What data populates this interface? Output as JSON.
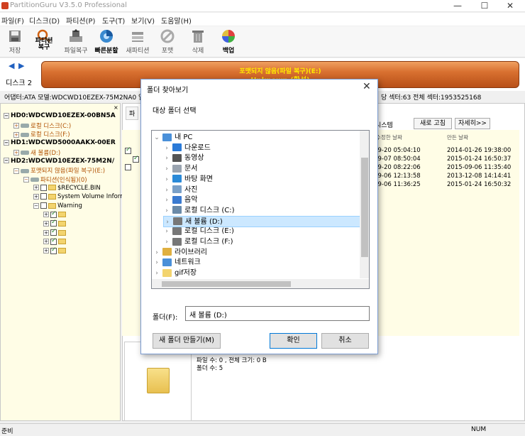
{
  "window": {
    "title": "PartitionGuru V3.5.0 Professional",
    "controls": [
      "—",
      "☐",
      "✕"
    ]
  },
  "menu": [
    "파일(F)",
    "디스크(D)",
    "파티션(P)",
    "도구(T)",
    "보기(V)",
    "도움말(H)"
  ],
  "toolbar": [
    {
      "label": "저장",
      "icon": "save-icon",
      "bold": false
    },
    {
      "label": "파티션\n복구",
      "icon": "search-icon",
      "bold": true
    },
    {
      "label": "파일복구",
      "icon": "file-recover-icon",
      "bold": false
    },
    {
      "label": "빠른분할",
      "icon": "quick-partition-icon",
      "bold": true
    },
    {
      "label": "새파티션",
      "icon": "new-partition-icon",
      "bold": false
    },
    {
      "label": "포맷",
      "icon": "format-icon",
      "bold": false
    },
    {
      "label": "삭제",
      "icon": "trash-icon",
      "bold": false
    },
    {
      "label": "백업",
      "icon": "backup-icon",
      "bold": true
    }
  ],
  "disk": {
    "label": "디스크 2",
    "line1": "포맷되지 않음(파일 복구)(E:)",
    "line2": "Unknown (활성)",
    "info": "어댑터:ATA  모델:WDCWD10EZEX-75M2NA0  일련",
    "info_right": "당 섹터:63  전체 섹터:1953525168"
  },
  "tree": [
    {
      "text": "HD0:WDCWD10EZEX-00BN5A",
      "indent": 0,
      "kind": "hd",
      "exp": "−"
    },
    {
      "text": "로컬 디스크(C:)",
      "indent": 1,
      "kind": "part",
      "exp": "+"
    },
    {
      "text": "로컬 디스크(F:)",
      "indent": 1,
      "kind": "part",
      "exp": "+"
    },
    {
      "text": "HD1:WDCWD5000AAKX-00ER",
      "indent": 0,
      "kind": "hd",
      "exp": "−"
    },
    {
      "text": "새 볼륨(D:)",
      "indent": 1,
      "kind": "part",
      "exp": "+"
    },
    {
      "text": "HD2:WDCWD10EZEX-75M2N/",
      "indent": 0,
      "kind": "hd",
      "exp": "−"
    },
    {
      "text": "포맷되지 않음(파일 복구)(E:)",
      "indent": 1,
      "kind": "part",
      "exp": "−"
    },
    {
      "text": "파티션(인식됨)(0)",
      "indent": 2,
      "kind": "part",
      "exp": "−"
    },
    {
      "text": "$RECYCLE.BIN",
      "indent": 3,
      "kind": "folder",
      "exp": "+"
    },
    {
      "text": "System Volume Inform",
      "indent": 3,
      "kind": "folder",
      "exp": "+"
    },
    {
      "text": "Warning",
      "indent": 3,
      "kind": "folder",
      "exp": "−"
    },
    {
      "text": "",
      "indent": 4,
      "kind": "folder",
      "exp": "+"
    },
    {
      "text": "",
      "indent": 4,
      "kind": "folder",
      "exp": "+"
    },
    {
      "text": "",
      "indent": 4,
      "kind": "folder",
      "exp": "+"
    },
    {
      "text": "",
      "indent": 4,
      "kind": "folder",
      "exp": "+"
    },
    {
      "text": "",
      "indent": 4,
      "kind": "folder",
      "exp": "+"
    }
  ],
  "right": {
    "tab": "파",
    "filesystem": "시스템",
    "refresh": "새로 고침",
    "detail": "자세히>>",
    "col_modified": "수정한 날짜",
    "col_created": "만든 날짜",
    "rows": [
      {
        "modified": "-09-20 05:04:10",
        "created": "2014-01-26 19:38:00"
      },
      {
        "modified": "-09-07 08:50:04",
        "created": "2015-01-24 16:50:37"
      },
      {
        "modified": "-09-20 08:22:06",
        "created": "2015-09-06 11:35:40"
      },
      {
        "modified": "-09-06 12:13:58",
        "created": "2013-12-08 14:14:41"
      },
      {
        "modified": "-09-06 11:36:25",
        "created": "2015-01-24 16:50:32"
      }
    ],
    "summary1": "파일 수: 0 , 전체 크기: 0 B",
    "summary2": "폴더 수: 5"
  },
  "status": {
    "left": "준비",
    "right": "NUM"
  },
  "dialog": {
    "title": "폴더 찾아보기",
    "subtitle": "대상 폴더 선택",
    "items": [
      {
        "label": "내 PC",
        "level": 0,
        "chev": "⌄",
        "icon": "pc-icon",
        "color": "#4a90d9"
      },
      {
        "label": "다운로드",
        "level": 1,
        "chev": "›",
        "icon": "download-icon",
        "color": "#2a7ad8"
      },
      {
        "label": "동영상",
        "level": 1,
        "chev": "›",
        "icon": "video-icon",
        "color": "#555555"
      },
      {
        "label": "문서",
        "level": 1,
        "chev": "›",
        "icon": "document-icon",
        "color": "#9aa4b0"
      },
      {
        "label": "바탕 화면",
        "level": 1,
        "chev": "›",
        "icon": "desktop-icon",
        "color": "#2a8ad8"
      },
      {
        "label": "사진",
        "level": 1,
        "chev": "›",
        "icon": "pictures-icon",
        "color": "#7aa0c8"
      },
      {
        "label": "음악",
        "level": 1,
        "chev": "›",
        "icon": "music-icon",
        "color": "#3a7ad0"
      },
      {
        "label": "로컬 디스크 (C:)",
        "level": 1,
        "chev": "›",
        "icon": "drive-icon",
        "color": "#6a8aa8"
      },
      {
        "label": "새 볼륨 (D:)",
        "level": 1,
        "chev": "›",
        "icon": "drive-icon",
        "color": "#777777",
        "selected": true
      },
      {
        "label": "로컬 디스크 (E:)",
        "level": 1,
        "chev": "›",
        "icon": "drive-icon",
        "color": "#777777"
      },
      {
        "label": "로컬 디스크 (F:)",
        "level": 1,
        "chev": "›",
        "icon": "drive-icon",
        "color": "#777777"
      },
      {
        "label": "라이브러리",
        "level": 0,
        "chev": "›",
        "icon": "library-icon",
        "color": "#e0b040"
      },
      {
        "label": "네트워크",
        "level": 0,
        "chev": "›",
        "icon": "network-icon",
        "color": "#4a90d9"
      },
      {
        "label": "gif저장",
        "level": 0,
        "chev": "›",
        "icon": "folder-icon",
        "color": "#f3d46e"
      }
    ],
    "folder_label": "폴더(F):",
    "folder_value": "새 볼륨 (D:)",
    "new_folder": "새 폴더 만들기(M)",
    "ok": "확인",
    "cancel": "취소"
  }
}
